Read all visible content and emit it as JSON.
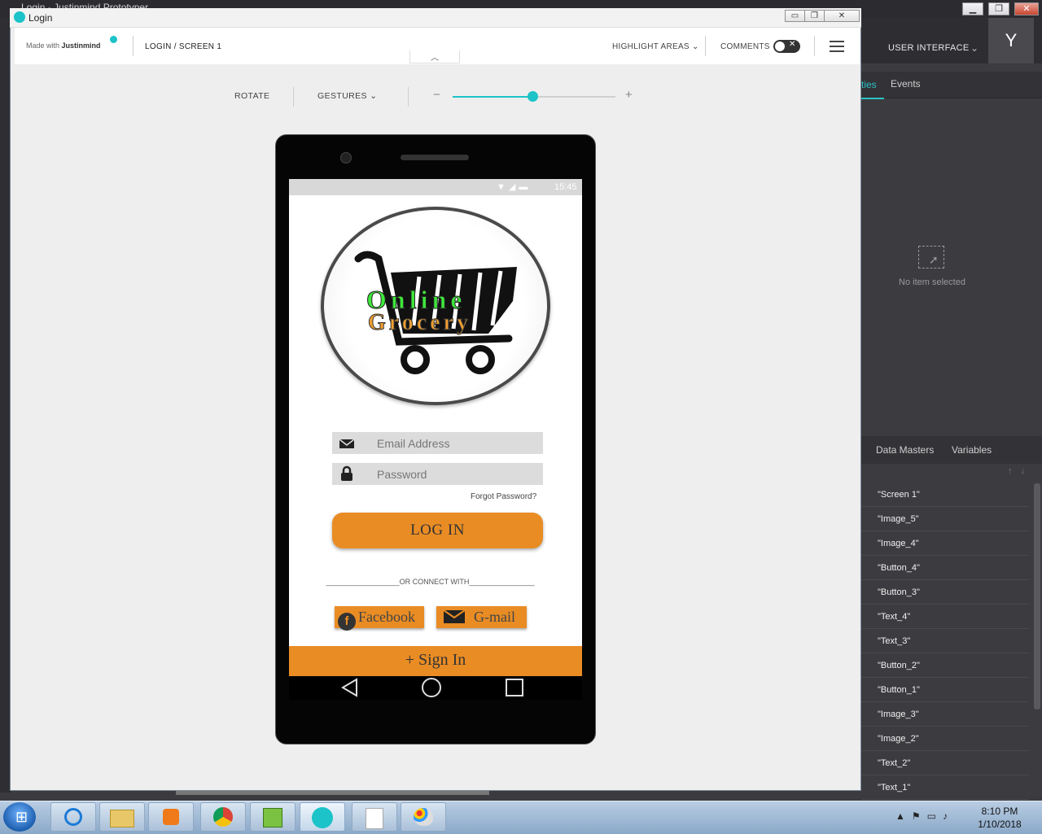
{
  "background_app": {
    "title": "Login - Justinmind Prototyper",
    "header": {
      "section_label": "USER INTERFACE",
      "avatar_letter": "Y"
    },
    "tabs": {
      "active_partial": "ties",
      "events": "Events"
    },
    "no_selection_text": "No item selected",
    "lower_tabs": {
      "data_masters": "Data Masters",
      "variables": "Variables"
    },
    "tree_items": [
      "\"Screen 1\"",
      "\"Image_5\"",
      "\"Image_4\"",
      "\"Button_4\"",
      "\"Button_3\"",
      "\"Text_4\"",
      "\"Text_3\"",
      "\"Button_2\"",
      "\"Button_1\"",
      "\"Image_3\"",
      "\"Image_2\"",
      "\"Text_2\"",
      "\"Text_1\""
    ]
  },
  "window": {
    "title": "Login",
    "controls": {
      "minimize": "▭",
      "restore": "❐",
      "close": "✕"
    }
  },
  "toolbar": {
    "made_with": "Made with",
    "brand": "Justinmind",
    "breadcrumb": "LOGIN / SCREEN 1",
    "highlight_areas": "HIGHLIGHT AREAS",
    "comments": "COMMENTS",
    "comments_toggle_on": false
  },
  "controls": {
    "rotate": "ROTATE",
    "gestures": "GESTURES",
    "zoom_minus": "−",
    "zoom_plus": "+",
    "zoom_level_fraction": 0.49
  },
  "phone": {
    "status_time": "15:45",
    "logo": {
      "word1": "Online",
      "word2": "Grocery",
      "word1_color": "#3ee83a",
      "word2_color": "#f0a030"
    },
    "email_placeholder": "Email Address",
    "password_placeholder": "Password",
    "forgot": "Forgot Password?",
    "login_button": "LOG IN",
    "or_connect": "__________________OR CONNECT WITH________________",
    "facebook": "Facebook",
    "facebook_icon_letter": "f",
    "gmail": "G-mail",
    "signin_bar": "+ Sign In",
    "accent_color": "#e98c24"
  },
  "taskbar": {
    "time": "8:10 PM",
    "date": "1/10/2018"
  }
}
